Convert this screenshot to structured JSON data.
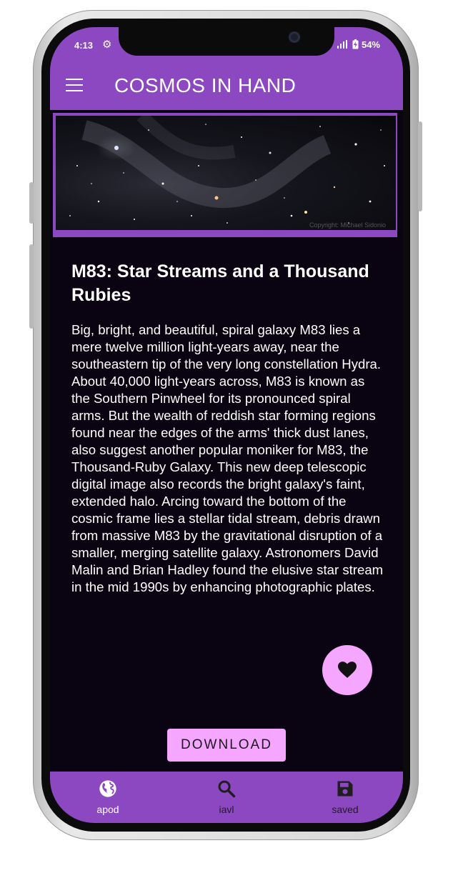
{
  "status_bar": {
    "time": "4:13",
    "battery": "54%"
  },
  "app_bar": {
    "title": "COSMOS IN HAND",
    "menu_icon": "hamburger-menu-icon"
  },
  "apod": {
    "image_credit": "Copyright: Michael Sidonio",
    "title": "M83: Star Streams and a Thousand Rubies",
    "explanation": "Big, bright, and beautiful, spiral galaxy M83 lies a mere twelve million light-years away, near the southeastern tip of the very long constellation Hydra. About 40,000 light-years across, M83 is known as the Southern Pinwheel for its pronounced spiral arms. But the wealth of reddish star forming regions found near the edges of the arms' thick dust lanes, also suggest another popular moniker for M83, the Thousand-Ruby Galaxy. This new deep telescopic digital image also records the bright galaxy's faint, extended halo. Arcing toward the bottom of the cosmic frame lies a stellar tidal stream, debris drawn from massive M83 by the gravitational disruption of a smaller, merging satellite galaxy. Astronomers David Malin and Brian Hadley found the elusive star stream in the mid 1990s by enhancing photographic plates."
  },
  "actions": {
    "download_label": "DOWNLOAD",
    "favorite_icon": "heart-icon"
  },
  "bottom_nav": {
    "items": [
      {
        "label": "apod",
        "icon": "globe-icon"
      },
      {
        "label": "iavl",
        "icon": "search-icon"
      },
      {
        "label": "saved",
        "icon": "save-icon"
      }
    ]
  },
  "colors": {
    "primary": "#8b48c0",
    "accent": "#f5a6ff",
    "background": "#0a0311"
  }
}
